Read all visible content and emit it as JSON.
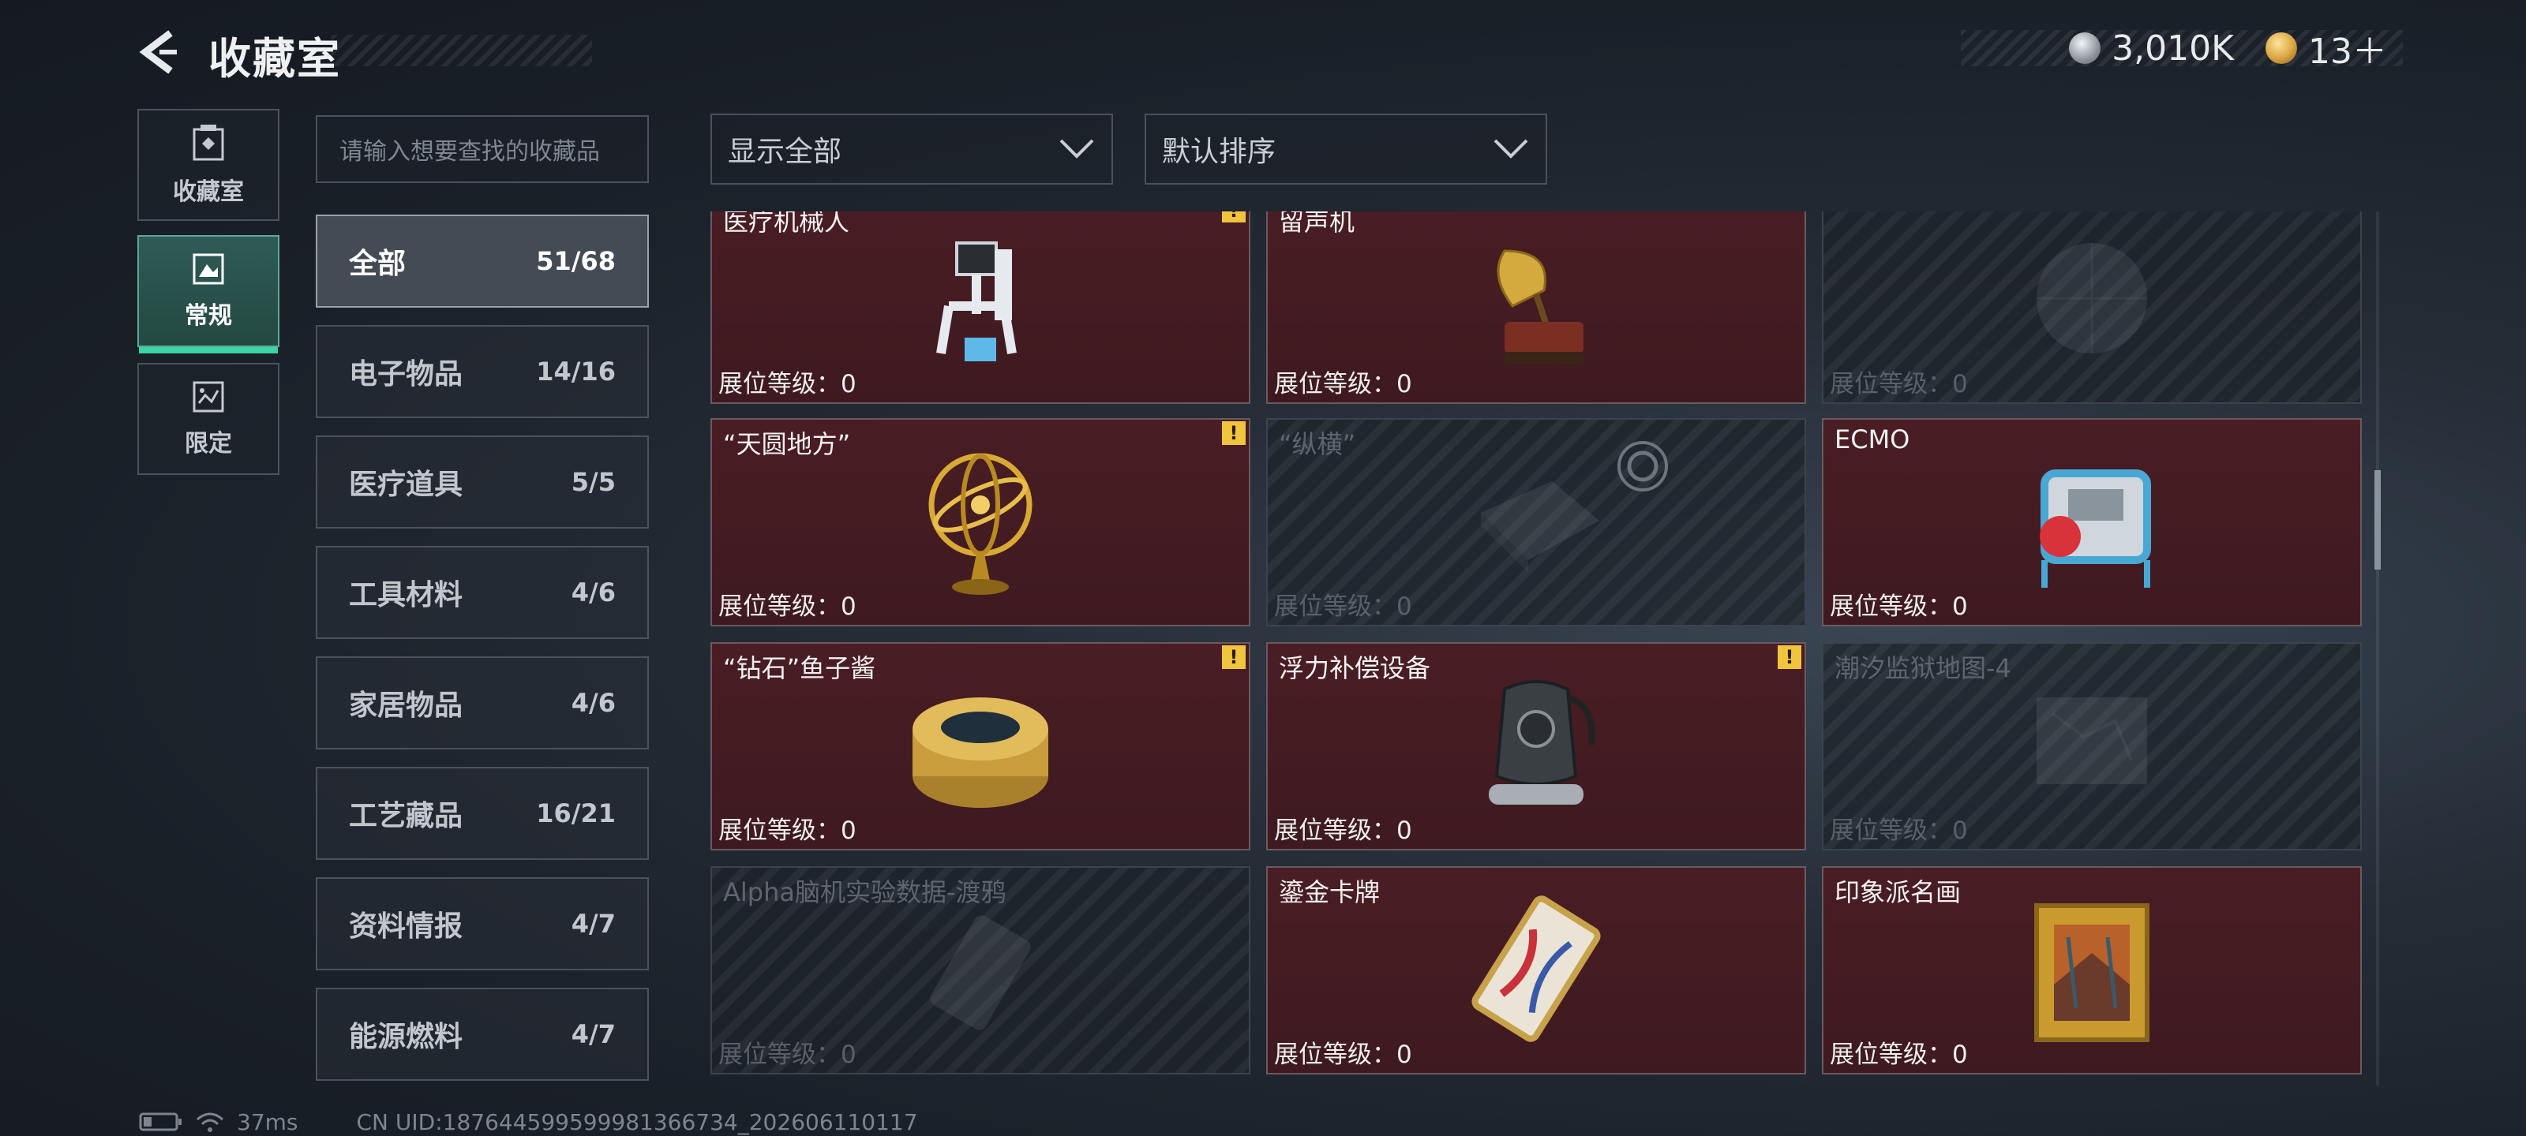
{
  "header": {
    "title": "收藏室",
    "currency": [
      {
        "icon": "silver-coin-icon",
        "value": "3,010K",
        "color": "#c8ccd2"
      },
      {
        "icon": "gold-triangle-coin-icon",
        "value": "13＋",
        "color": "#d9a441"
      }
    ]
  },
  "nav": [
    {
      "label": "收藏室",
      "icon": "collection-room-icon"
    },
    {
      "label": "常规",
      "icon": "regular-items-icon",
      "active": true
    },
    {
      "label": "限定",
      "icon": "limited-items-icon"
    }
  ],
  "search": {
    "placeholder": "请输入想要查找的收藏品"
  },
  "filters": {
    "show": "显示全部",
    "sort": "默认排序"
  },
  "categories": [
    {
      "name": "全部",
      "count": "51/68",
      "active": true
    },
    {
      "name": "电子物品",
      "count": "14/16"
    },
    {
      "name": "医疗道具",
      "count": "5/5"
    },
    {
      "name": "工具材料",
      "count": "4/6"
    },
    {
      "name": "家居物品",
      "count": "4/6"
    },
    {
      "name": "工艺藏品",
      "count": "16/21"
    },
    {
      "name": "资料情报",
      "count": "4/7"
    },
    {
      "name": "能源燃料",
      "count": "4/7"
    }
  ],
  "level_label": "展位等级：",
  "items": [
    {
      "name": "医疗机械人",
      "level": "0",
      "locked": false,
      "warn": true,
      "icon": "medical-robot-icon"
    },
    {
      "name": "留声机",
      "level": "0",
      "locked": false,
      "warn": false,
      "icon": "gramophone-icon"
    },
    {
      "name": "",
      "level": "0",
      "locked": true,
      "warn": false,
      "icon": "globe-icon"
    },
    {
      "name": "“天圆地方”",
      "level": "0",
      "locked": false,
      "warn": true,
      "icon": "armillary-sphere-icon"
    },
    {
      "name": "“纵横”",
      "level": "0",
      "locked": true,
      "warn": false,
      "icon": "chessboard-icon",
      "lockring": true
    },
    {
      "name": "ECMO",
      "level": "0",
      "locked": false,
      "warn": false,
      "icon": "ecmo-machine-icon"
    },
    {
      "name": "“钻石”鱼子酱",
      "level": "0",
      "locked": false,
      "warn": true,
      "icon": "caviar-tin-icon"
    },
    {
      "name": "浮力补偿设备",
      "level": "0",
      "locked": false,
      "warn": true,
      "icon": "buoyancy-device-icon"
    },
    {
      "name": "潮汐监狱地图-4",
      "level": "0",
      "locked": true,
      "warn": false,
      "icon": "map-icon"
    },
    {
      "name": "Alpha脑机实验数据-渡鸦",
      "level": "0",
      "locked": true,
      "warn": false,
      "icon": "data-drive-icon"
    },
    {
      "name": "鎏金卡牌",
      "level": "0",
      "locked": false,
      "warn": false,
      "icon": "gilded-card-icon"
    },
    {
      "name": "印象派名画",
      "level": "0",
      "locked": false,
      "warn": false,
      "icon": "framed-painting-icon"
    }
  ],
  "footer": {
    "ping": "37ms",
    "uid": "CN UID:187644599599981366734_202606110117"
  }
}
